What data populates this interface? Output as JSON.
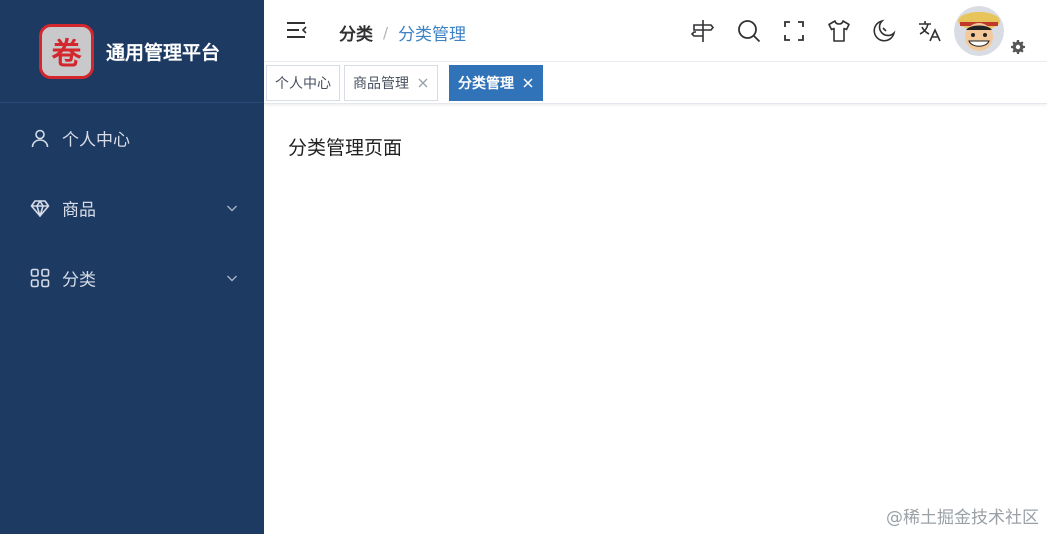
{
  "app": {
    "title": "通用管理平台",
    "logo_char": "卷"
  },
  "sidebar": {
    "items": [
      {
        "label": "个人中心",
        "icon": "user-icon"
      },
      {
        "label": "商品",
        "icon": "gem-icon",
        "expandable": true
      },
      {
        "label": "分类",
        "icon": "grid-icon",
        "expandable": true
      }
    ]
  },
  "breadcrumb": {
    "items": [
      "分类",
      "分类管理"
    ],
    "separator": "/"
  },
  "header_icons": [
    "signpost-icon",
    "search-icon",
    "fullscreen-icon",
    "shirt-icon",
    "moon-icon",
    "translate-icon"
  ],
  "tabs": [
    {
      "label": "个人中心",
      "closable": false,
      "active": false
    },
    {
      "label": "商品管理",
      "closable": true,
      "active": false
    },
    {
      "label": "分类管理",
      "closable": true,
      "active": true
    }
  ],
  "main": {
    "text": "分类管理页面"
  },
  "watermark": "@稀土掘金技术社区",
  "colors": {
    "sidebar_bg": "#1d3a63",
    "accent": "#3073b8",
    "breadcrumb_active": "#3c82c4",
    "logo_red": "#d4262d"
  }
}
